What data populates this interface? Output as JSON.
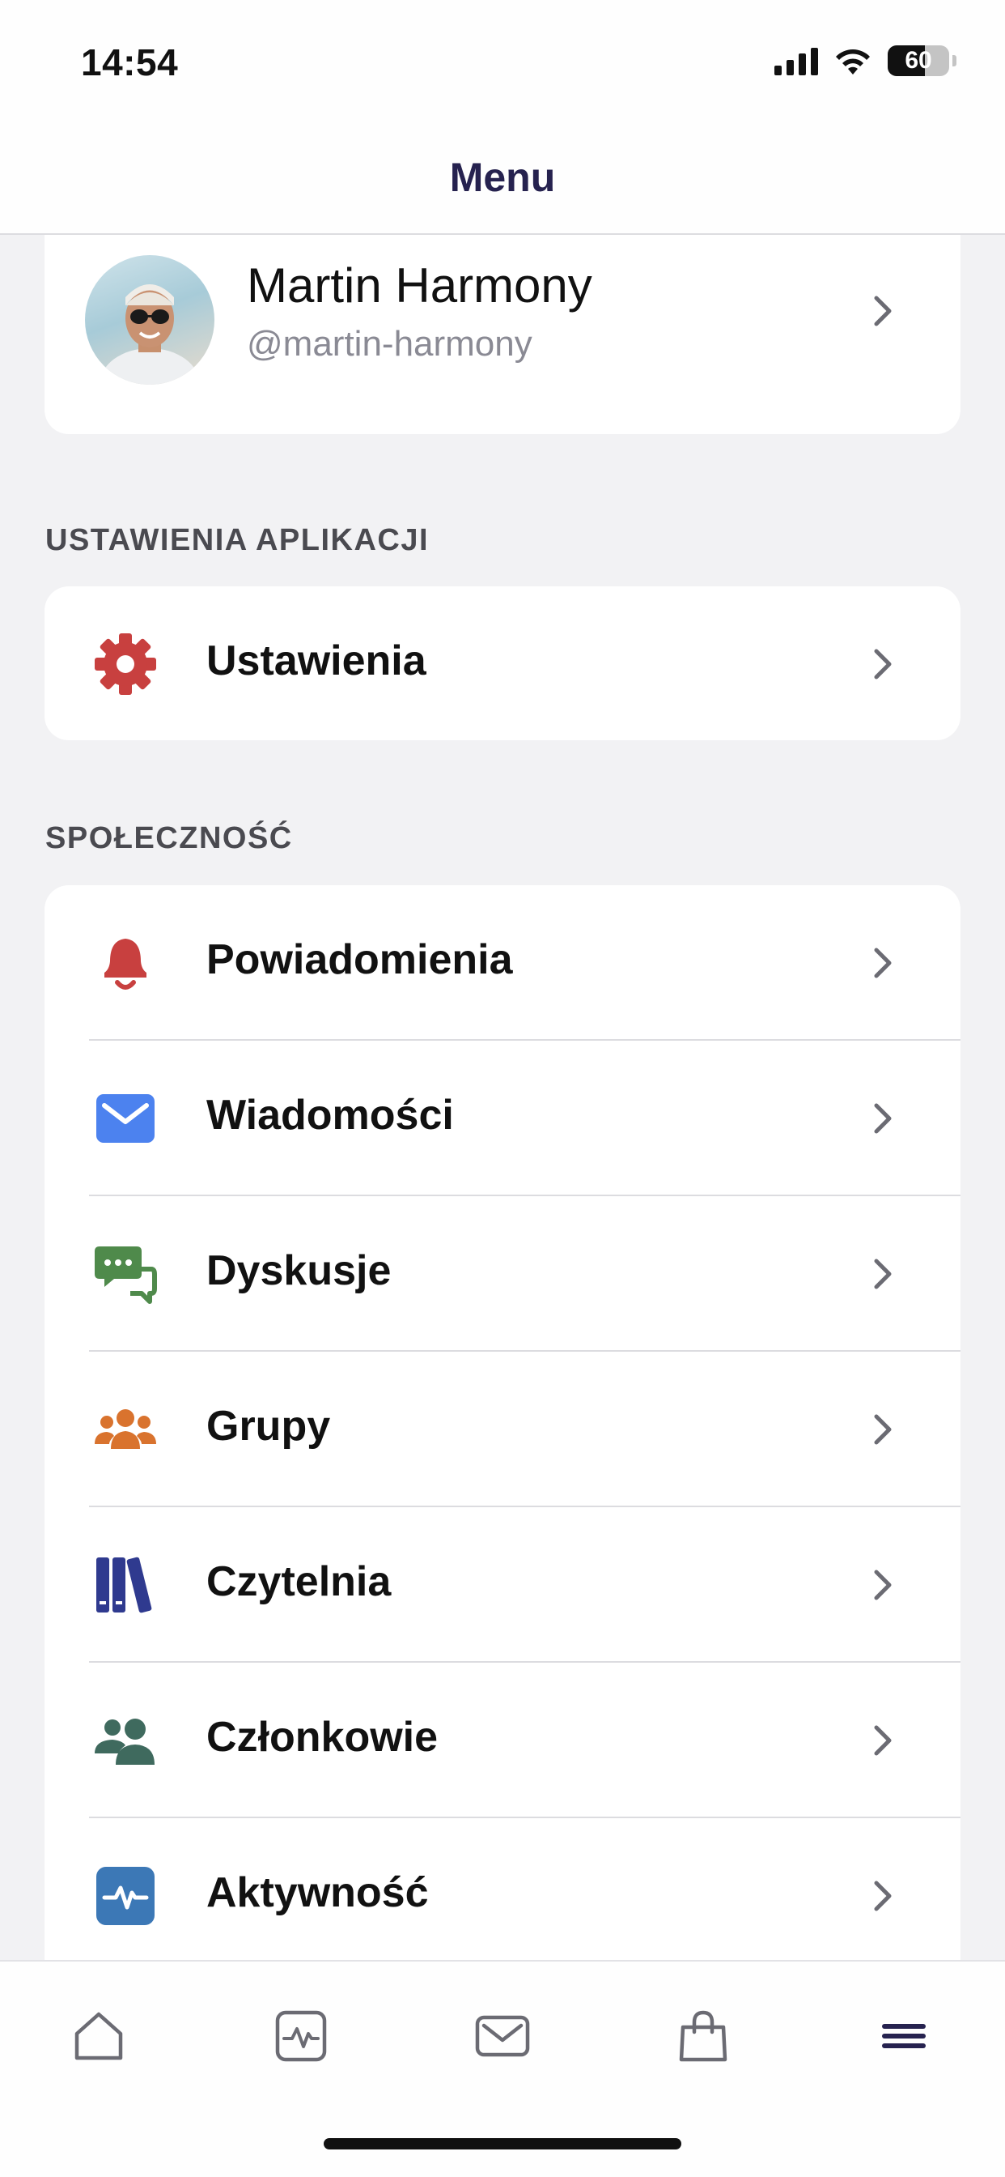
{
  "status_bar": {
    "time": "14:54",
    "battery": "60",
    "battery_level": 0.6
  },
  "header": {
    "title": "Menu"
  },
  "profile": {
    "name": "Martin Harmony",
    "handle": "@martin-harmony"
  },
  "sections": {
    "app_settings": {
      "title": "USTAWIENIA APLIKACJI",
      "items": [
        {
          "label": "Ustawienia",
          "icon": "gear-icon",
          "color": "#c8403f"
        }
      ]
    },
    "community": {
      "title": "SPOŁECZNOŚĆ",
      "items": [
        {
          "label": "Powiadomienia",
          "icon": "bell-icon",
          "color": "#c8403f"
        },
        {
          "label": "Wiadomości",
          "icon": "envelope-icon",
          "color": "#4c82ef"
        },
        {
          "label": "Dyskusje",
          "icon": "chat-bubbles-icon",
          "color": "#4f8a4b"
        },
        {
          "label": "Grupy",
          "icon": "group-icon",
          "color": "#d9732e"
        },
        {
          "label": "Czytelnia",
          "icon": "books-icon",
          "color": "#2f3a8f"
        },
        {
          "label": "Członkowie",
          "icon": "members-icon",
          "color": "#3f6a5e"
        },
        {
          "label": "Aktywność",
          "icon": "activity-icon",
          "color": "#3c78b6"
        }
      ]
    }
  },
  "tab_bar": {
    "tabs": [
      {
        "icon": "home-icon"
      },
      {
        "icon": "activity-tab-icon"
      },
      {
        "icon": "mail-tab-icon"
      },
      {
        "icon": "shopping-bag-icon"
      },
      {
        "icon": "menu-icon",
        "active": true
      }
    ]
  },
  "colors": {
    "accent": "#26224f",
    "chevron": "#6b6b73",
    "tab_icon": "#6b6b73"
  }
}
